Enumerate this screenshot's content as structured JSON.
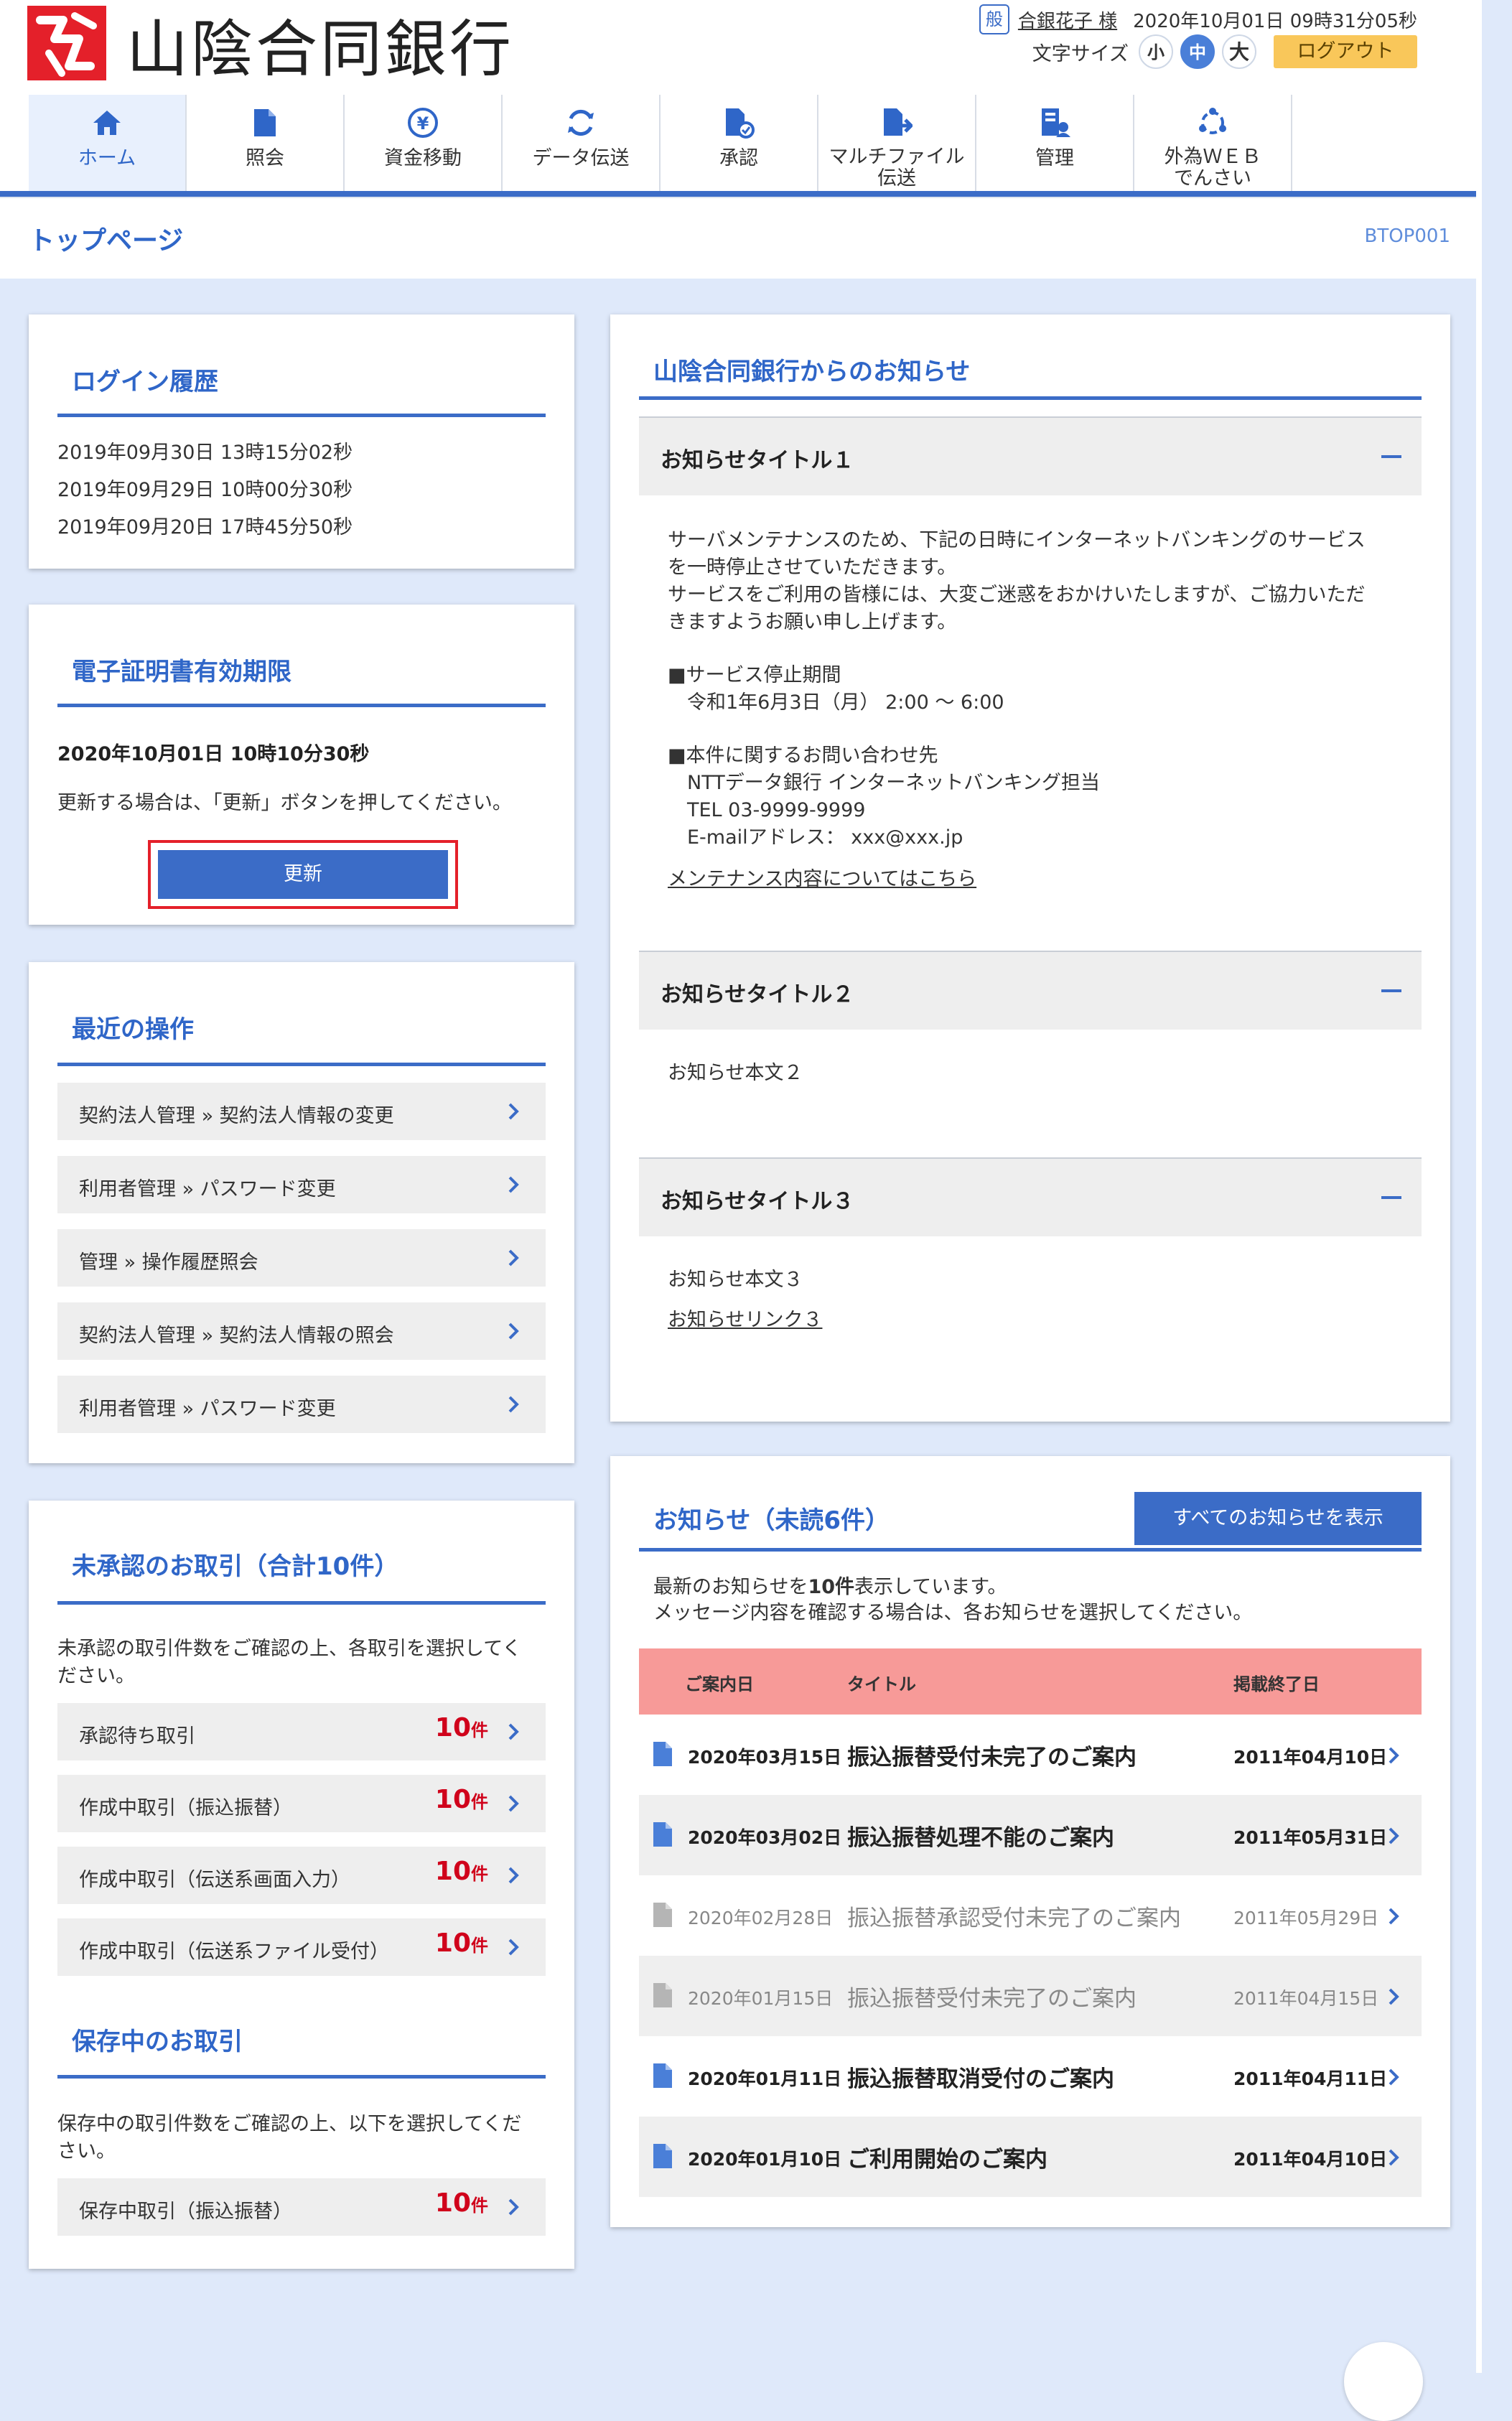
{
  "header": {
    "bank_name": "山陰合同銀行",
    "user_type_badge": "般",
    "user_name": "合銀花子 様",
    "datetime": "2020年10月01日 09時31分05秒",
    "font_size_label": "文字サイズ",
    "font_size_small": "小",
    "font_size_medium": "中",
    "font_size_large": "大",
    "logout_label": "ログアウト"
  },
  "nav": {
    "items": [
      {
        "label": "ホーム",
        "icon": "home-icon"
      },
      {
        "label": "照会",
        "icon": "document-icon"
      },
      {
        "label": "資金移動",
        "icon": "yen-transfer-icon"
      },
      {
        "label": "データ伝送",
        "icon": "refresh-icon"
      },
      {
        "label": "承認",
        "icon": "approve-icon"
      },
      {
        "label1": "マルチファイル",
        "label2": "伝送",
        "icon": "file-upload-icon"
      },
      {
        "label": "管理",
        "icon": "admin-icon"
      },
      {
        "label1": "外為ＷＥＢ",
        "label2": "でんさい",
        "icon": "network-icon"
      }
    ]
  },
  "page": {
    "title": "トップページ",
    "id": "BTOP001"
  },
  "login_history": {
    "title": "ログイン履歴",
    "entries": [
      "2019年09月30日 13時15分02秒",
      "2019年09月29日 10時00分30秒",
      "2019年09月20日 17時45分50秒"
    ]
  },
  "certificate": {
    "title": "電子証明書有効期限",
    "expiry": "2020年10月01日 10時10分30秒",
    "note": "更新する場合は、「更新」ボタンを押してください。",
    "update_label": "更新"
  },
  "recent_ops": {
    "title": "最近の操作",
    "items": [
      "契約法人管理 » 契約法人情報の変更",
      "利用者管理 » パスワード変更",
      "管理 » 操作履歴照会",
      "契約法人管理 » 契約法人情報の照会",
      "利用者管理 » パスワード変更"
    ]
  },
  "pending": {
    "title": "未承認のお取引（合計10件）",
    "note1": "未承認の取引件数をご確認の上、各取引を選択してく",
    "note2": "ださい。",
    "unit": "件",
    "items": [
      {
        "label": "承認待ち取引",
        "count": "10"
      },
      {
        "label": "作成中取引（振込振替）",
        "count": "10"
      },
      {
        "label": "作成中取引（伝送系画面入力）",
        "count": "10"
      },
      {
        "label": "作成中取引（伝送系ファイル受付）",
        "count": "10"
      }
    ],
    "saved_title": "保存中のお取引",
    "saved_note1": "保存中の取引件数をご確認の上、以下を選択してくだ",
    "saved_note2": "さい。",
    "saved_items": [
      {
        "label": "保存中取引（振込振替）",
        "count": "10"
      }
    ]
  },
  "bank_news": {
    "title": "山陰合同銀行からのお知らせ",
    "item1": {
      "title": "お知らせタイトル１",
      "lines": [
        "サーバメンテナンスのため、下記の日時にインターネットバンキングのサービス",
        "を一時停止させていただきます。",
        "サービスをご利用の皆様には、大変ご迷惑をおかけいたしますが、ご協力いただ",
        "きますようお願い申し上げます。",
        "■サービス停止期間",
        "　令和1年6月3日（月） 2:00 ～ 6:00",
        "■本件に関するお問い合わせ先",
        "　NTTデータ銀行 インターネットバンキング担当",
        "　TEL 03-9999-9999",
        "　E-mailアドレス： xxx@xxx.jp"
      ],
      "link": "メンテナンス内容についてはこちら"
    },
    "item2": {
      "title": "お知らせタイトル２",
      "body": "お知らせ本文２"
    },
    "item3": {
      "title": "お知らせタイトル３",
      "body": "お知らせ本文３",
      "link": "お知らせリンク３"
    }
  },
  "notices": {
    "title": "お知らせ（未読6件）",
    "show_all_label": "すべてのお知らせを表示",
    "desc1_pre": "最新のお知らせを",
    "desc1_count": "10件",
    "desc1_post": "表示しています。",
    "desc2": "メッセージ内容を確認する場合は、各お知らせを選択してください。",
    "columns": {
      "date": "ご案内日",
      "title": "タイトル",
      "end": "掲載終了日"
    },
    "rows": [
      {
        "date": "2020年03月15日",
        "title": "振込振替受付未完了のご案内",
        "end": "2011年04月10日",
        "read": false
      },
      {
        "date": "2020年03月02日",
        "title": "振込振替処理不能のご案内",
        "end": "2011年05月31日",
        "read": false
      },
      {
        "date": "2020年02月28日",
        "title": "振込振替承認受付未完了のご案内",
        "end": "2011年05月29日",
        "read": true
      },
      {
        "date": "2020年01月15日",
        "title": "振込振替受付未完了のご案内",
        "end": "2011年04月15日",
        "read": true
      },
      {
        "date": "2020年01月11日",
        "title": "振込振替取消受付のご案内",
        "end": "2011年04月11日",
        "read": false
      },
      {
        "date": "2020年01月10日",
        "title": "ご利用開始のご案内",
        "end": "2011年04月10日",
        "read": false
      }
    ]
  },
  "colors": {
    "accent": "#3b6cc7",
    "brand_red": "#e4202a",
    "table_header": "#f79a98",
    "count_red": "#d0021b",
    "logout_bg": "#f9c75a"
  }
}
